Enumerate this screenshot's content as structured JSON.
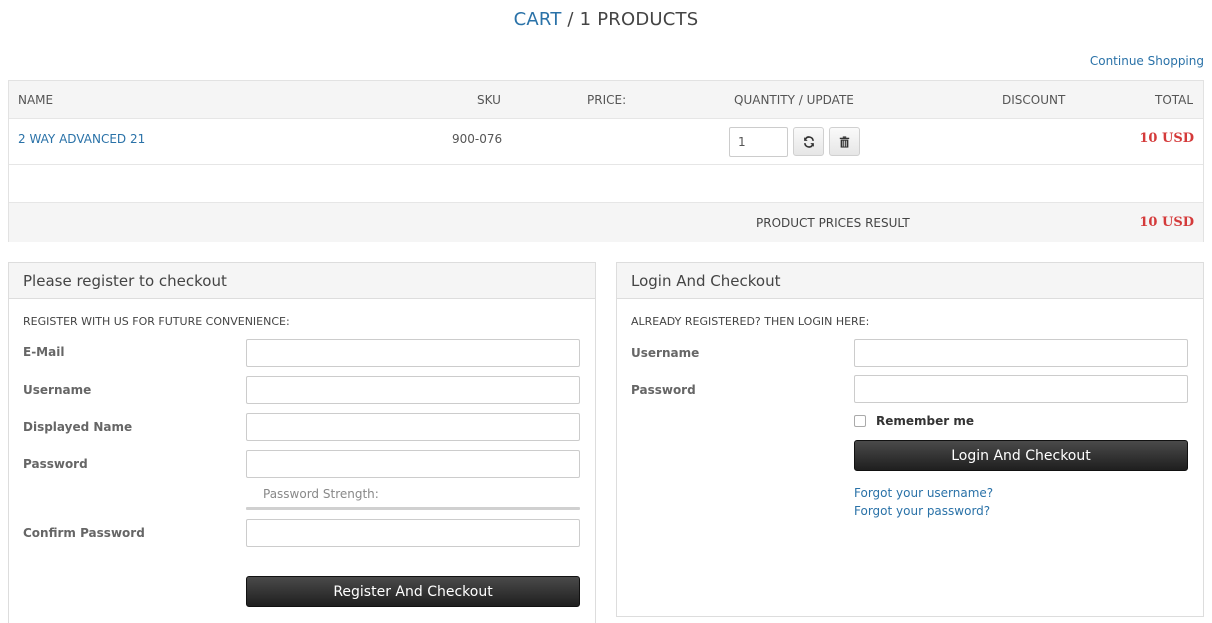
{
  "header": {
    "cart_link": "CART",
    "title_rest": " / 1 PRODUCTS"
  },
  "continue_shopping": "Continue Shopping",
  "cart": {
    "columns": [
      "NAME",
      "SKU",
      "PRICE:",
      "QUANTITY / UPDATE",
      "DISCOUNT",
      "TOTAL"
    ],
    "items": [
      {
        "name": "2 WAY ADVANCED 21",
        "sku": "900-076",
        "price": "",
        "quantity": "1",
        "discount": "",
        "total": "10 USD"
      }
    ],
    "result_label": "PRODUCT PRICES RESULT",
    "result_total": "10 USD"
  },
  "register": {
    "title": "Please register to checkout",
    "subtitle": "REGISTER WITH US FOR FUTURE CONVENIENCE:",
    "email_label": "E-Mail",
    "username_label": "Username",
    "displayed_name_label": "Displayed Name",
    "password_label": "Password",
    "password_strength_label": "Password Strength:",
    "confirm_password_label": "Confirm Password",
    "button": "Register And Checkout"
  },
  "login": {
    "title": "Login And Checkout",
    "subtitle": "ALREADY REGISTERED? THEN LOGIN HERE:",
    "username_label": "Username",
    "password_label": "Password",
    "remember_label": "Remember me",
    "button": "Login And Checkout",
    "forgot_username": "Forgot your username?",
    "forgot_password": "Forgot your password?"
  },
  "icons": {
    "update": "refresh-icon",
    "delete": "trash-icon"
  },
  "colors": {
    "link": "#2a72a8",
    "total": "#d43a3a",
    "button": "#2b2b2b"
  }
}
